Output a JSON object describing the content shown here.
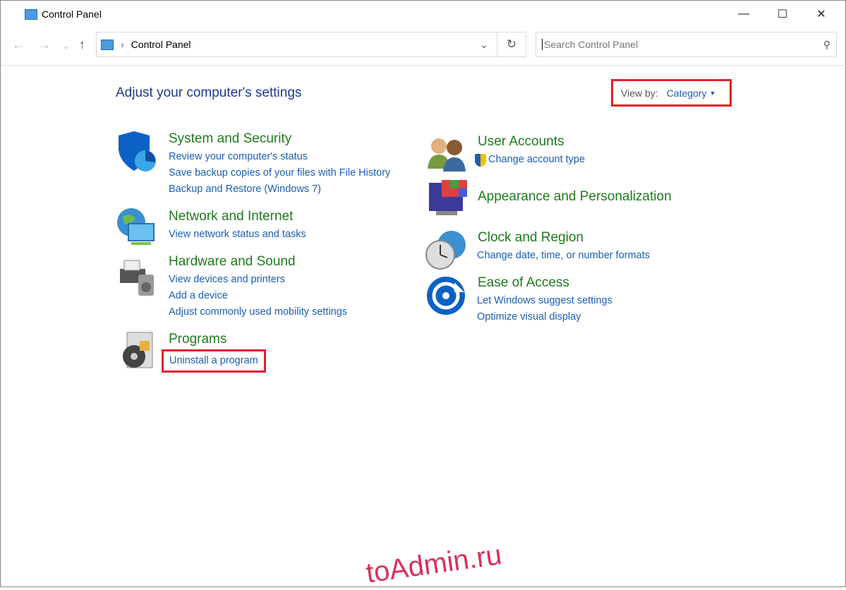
{
  "window": {
    "title": "Control Panel"
  },
  "address": {
    "breadcrumb": "Control Panel"
  },
  "search": {
    "placeholder": "Search Control Panel"
  },
  "main": {
    "heading": "Adjust your computer's settings",
    "view_by_label": "View by:",
    "view_by_value": "Category",
    "categories": [
      {
        "title": "System and Security",
        "links": [
          "Review your computer's status",
          "Save backup copies of your files with File History",
          "Backup and Restore (Windows 7)"
        ]
      },
      {
        "title": "Network and Internet",
        "links": [
          "View network status and tasks"
        ]
      },
      {
        "title": "Hardware and Sound",
        "links": [
          "View devices and printers",
          "Add a device",
          "Adjust commonly used mobility settings"
        ]
      },
      {
        "title": "Programs",
        "links": [
          "Uninstall a program"
        ]
      },
      {
        "title": "User Accounts",
        "links": [
          "Change account type"
        ]
      },
      {
        "title": "Appearance and Personalization",
        "links": []
      },
      {
        "title": "Clock and Region",
        "links": [
          "Change date, time, or number formats"
        ]
      },
      {
        "title": "Ease of Access",
        "links": [
          "Let Windows suggest settings",
          "Optimize visual display"
        ]
      }
    ]
  },
  "watermark": "toAdmin.ru",
  "colors": {
    "heading": "#1e3a8a",
    "category": "#1e7a1e",
    "link": "#1a5fb4",
    "highlight": "#e0202a"
  }
}
